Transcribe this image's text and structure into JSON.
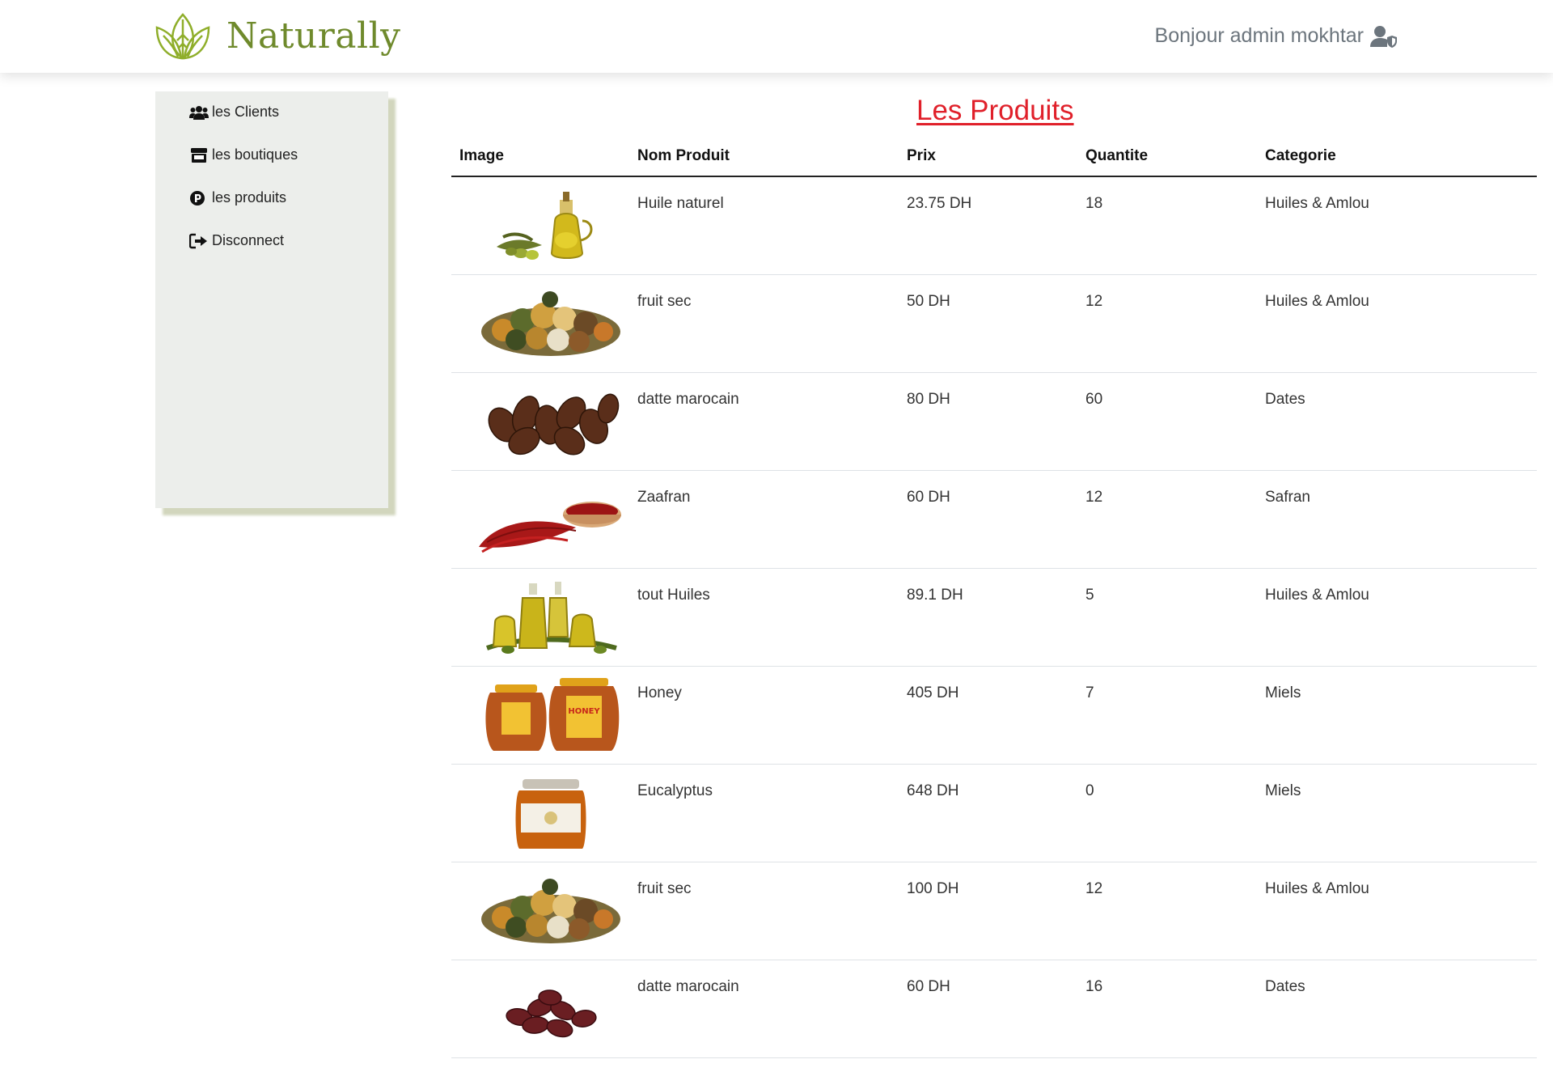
{
  "header": {
    "brand": "Naturally",
    "greeting": "Bonjour admin mokhtar"
  },
  "sidebar": {
    "items": [
      {
        "label": "les Clients",
        "icon": "users-icon"
      },
      {
        "label": "les boutiques",
        "icon": "store-icon"
      },
      {
        "label": "les produits",
        "icon": "product-p-icon"
      },
      {
        "label": "Disconnect",
        "icon": "logout-icon"
      }
    ]
  },
  "main": {
    "title": "Les Produits",
    "columns": [
      "Image",
      "Nom Produit",
      "Prix",
      "Quantite",
      "Categorie"
    ],
    "rows": [
      {
        "image": "olive-oil-image",
        "name": "Huile naturel",
        "price": "23.75 DH",
        "qty": "18",
        "category": "Huiles & Amlou"
      },
      {
        "image": "dried-fruit-image",
        "name": "fruit sec",
        "price": "50 DH",
        "qty": "12",
        "category": "Huiles & Amlou"
      },
      {
        "image": "dates-image",
        "name": "datte marocain",
        "price": "80 DH",
        "qty": "60",
        "category": "Dates"
      },
      {
        "image": "saffron-image",
        "name": "Zaafran",
        "price": "60 DH",
        "qty": "12",
        "category": "Safran"
      },
      {
        "image": "oils-bottles-image",
        "name": "tout Huiles",
        "price": "89.1 DH",
        "qty": "5",
        "category": "Huiles & Amlou"
      },
      {
        "image": "honey-jars-image",
        "name": "Honey",
        "price": "405 DH",
        "qty": "7",
        "category": "Miels"
      },
      {
        "image": "eucalyptus-honey-image",
        "name": "Eucalyptus",
        "price": "648 DH",
        "qty": "0",
        "category": "Miels"
      },
      {
        "image": "dried-fruit-image",
        "name": "fruit sec",
        "price": "100 DH",
        "qty": "12",
        "category": "Huiles & Amlou"
      },
      {
        "image": "dates-small-image",
        "name": "datte marocain",
        "price": "60 DH",
        "qty": "16",
        "category": "Dates"
      }
    ]
  },
  "colors": {
    "brand": "#6f8a2c",
    "title": "#e0202a",
    "sidebar_bg": "#eceeeb"
  }
}
